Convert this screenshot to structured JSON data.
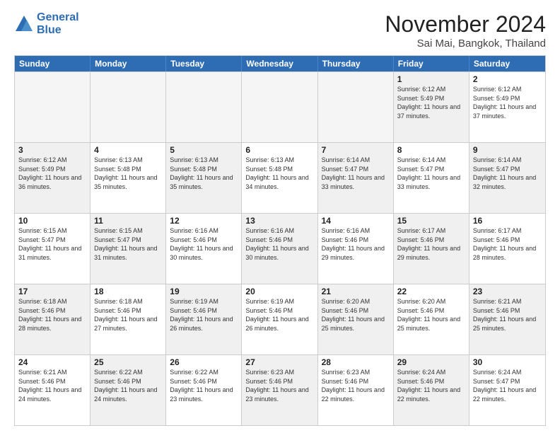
{
  "logo": {
    "line1": "General",
    "line2": "Blue"
  },
  "title": "November 2024",
  "location": "Sai Mai, Bangkok, Thailand",
  "header_days": [
    "Sunday",
    "Monday",
    "Tuesday",
    "Wednesday",
    "Thursday",
    "Friday",
    "Saturday"
  ],
  "rows": [
    [
      {
        "day": "",
        "text": "",
        "empty": true
      },
      {
        "day": "",
        "text": "",
        "empty": true
      },
      {
        "day": "",
        "text": "",
        "empty": true
      },
      {
        "day": "",
        "text": "",
        "empty": true
      },
      {
        "day": "",
        "text": "",
        "empty": true
      },
      {
        "day": "1",
        "text": "Sunrise: 6:12 AM\nSunset: 5:49 PM\nDaylight: 11 hours and 37 minutes.",
        "shaded": true
      },
      {
        "day": "2",
        "text": "Sunrise: 6:12 AM\nSunset: 5:49 PM\nDaylight: 11 hours and 37 minutes.",
        "shaded": false
      }
    ],
    [
      {
        "day": "3",
        "text": "Sunrise: 6:12 AM\nSunset: 5:49 PM\nDaylight: 11 hours and 36 minutes.",
        "shaded": true
      },
      {
        "day": "4",
        "text": "Sunrise: 6:13 AM\nSunset: 5:48 PM\nDaylight: 11 hours and 35 minutes.",
        "shaded": false
      },
      {
        "day": "5",
        "text": "Sunrise: 6:13 AM\nSunset: 5:48 PM\nDaylight: 11 hours and 35 minutes.",
        "shaded": true
      },
      {
        "day": "6",
        "text": "Sunrise: 6:13 AM\nSunset: 5:48 PM\nDaylight: 11 hours and 34 minutes.",
        "shaded": false
      },
      {
        "day": "7",
        "text": "Sunrise: 6:14 AM\nSunset: 5:47 PM\nDaylight: 11 hours and 33 minutes.",
        "shaded": true
      },
      {
        "day": "8",
        "text": "Sunrise: 6:14 AM\nSunset: 5:47 PM\nDaylight: 11 hours and 33 minutes.",
        "shaded": false
      },
      {
        "day": "9",
        "text": "Sunrise: 6:14 AM\nSunset: 5:47 PM\nDaylight: 11 hours and 32 minutes.",
        "shaded": true
      }
    ],
    [
      {
        "day": "10",
        "text": "Sunrise: 6:15 AM\nSunset: 5:47 PM\nDaylight: 11 hours and 31 minutes.",
        "shaded": false
      },
      {
        "day": "11",
        "text": "Sunrise: 6:15 AM\nSunset: 5:47 PM\nDaylight: 11 hours and 31 minutes.",
        "shaded": true
      },
      {
        "day": "12",
        "text": "Sunrise: 6:16 AM\nSunset: 5:46 PM\nDaylight: 11 hours and 30 minutes.",
        "shaded": false
      },
      {
        "day": "13",
        "text": "Sunrise: 6:16 AM\nSunset: 5:46 PM\nDaylight: 11 hours and 30 minutes.",
        "shaded": true
      },
      {
        "day": "14",
        "text": "Sunrise: 6:16 AM\nSunset: 5:46 PM\nDaylight: 11 hours and 29 minutes.",
        "shaded": false
      },
      {
        "day": "15",
        "text": "Sunrise: 6:17 AM\nSunset: 5:46 PM\nDaylight: 11 hours and 29 minutes.",
        "shaded": true
      },
      {
        "day": "16",
        "text": "Sunrise: 6:17 AM\nSunset: 5:46 PM\nDaylight: 11 hours and 28 minutes.",
        "shaded": false
      }
    ],
    [
      {
        "day": "17",
        "text": "Sunrise: 6:18 AM\nSunset: 5:46 PM\nDaylight: 11 hours and 28 minutes.",
        "shaded": true
      },
      {
        "day": "18",
        "text": "Sunrise: 6:18 AM\nSunset: 5:46 PM\nDaylight: 11 hours and 27 minutes.",
        "shaded": false
      },
      {
        "day": "19",
        "text": "Sunrise: 6:19 AM\nSunset: 5:46 PM\nDaylight: 11 hours and 26 minutes.",
        "shaded": true
      },
      {
        "day": "20",
        "text": "Sunrise: 6:19 AM\nSunset: 5:46 PM\nDaylight: 11 hours and 26 minutes.",
        "shaded": false
      },
      {
        "day": "21",
        "text": "Sunrise: 6:20 AM\nSunset: 5:46 PM\nDaylight: 11 hours and 25 minutes.",
        "shaded": true
      },
      {
        "day": "22",
        "text": "Sunrise: 6:20 AM\nSunset: 5:46 PM\nDaylight: 11 hours and 25 minutes.",
        "shaded": false
      },
      {
        "day": "23",
        "text": "Sunrise: 6:21 AM\nSunset: 5:46 PM\nDaylight: 11 hours and 25 minutes.",
        "shaded": true
      }
    ],
    [
      {
        "day": "24",
        "text": "Sunrise: 6:21 AM\nSunset: 5:46 PM\nDaylight: 11 hours and 24 minutes.",
        "shaded": false
      },
      {
        "day": "25",
        "text": "Sunrise: 6:22 AM\nSunset: 5:46 PM\nDaylight: 11 hours and 24 minutes.",
        "shaded": true
      },
      {
        "day": "26",
        "text": "Sunrise: 6:22 AM\nSunset: 5:46 PM\nDaylight: 11 hours and 23 minutes.",
        "shaded": false
      },
      {
        "day": "27",
        "text": "Sunrise: 6:23 AM\nSunset: 5:46 PM\nDaylight: 11 hours and 23 minutes.",
        "shaded": true
      },
      {
        "day": "28",
        "text": "Sunrise: 6:23 AM\nSunset: 5:46 PM\nDaylight: 11 hours and 22 minutes.",
        "shaded": false
      },
      {
        "day": "29",
        "text": "Sunrise: 6:24 AM\nSunset: 5:46 PM\nDaylight: 11 hours and 22 minutes.",
        "shaded": true
      },
      {
        "day": "30",
        "text": "Sunrise: 6:24 AM\nSunset: 5:47 PM\nDaylight: 11 hours and 22 minutes.",
        "shaded": false
      }
    ]
  ]
}
